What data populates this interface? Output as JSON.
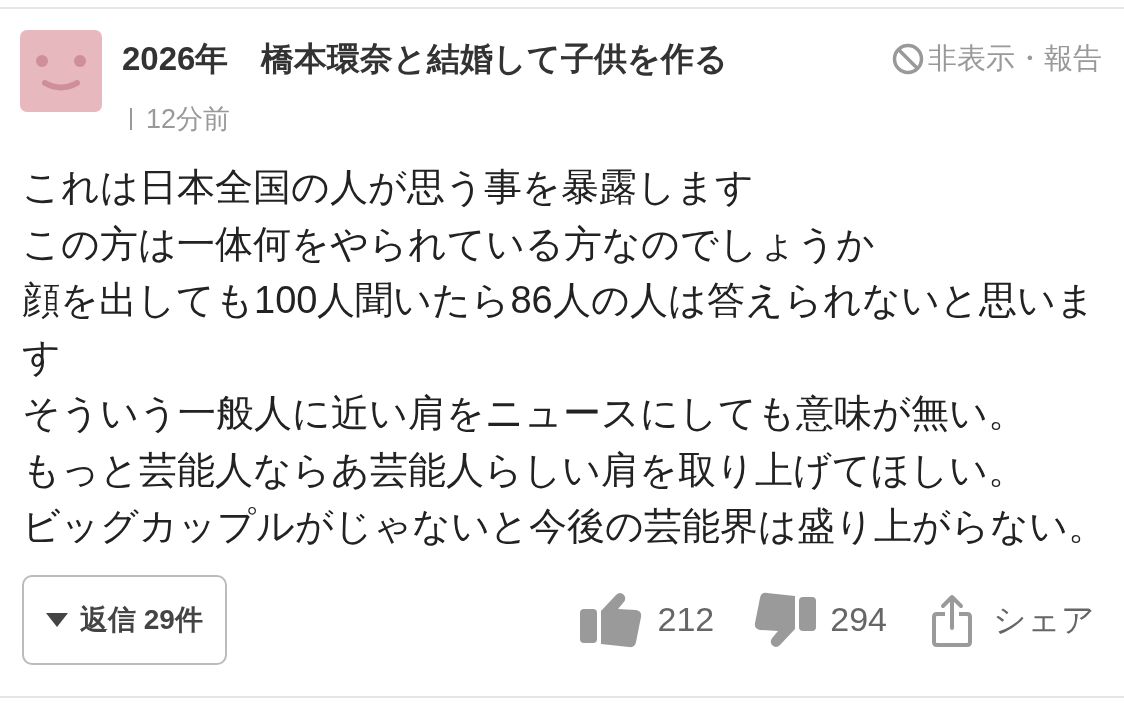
{
  "comment": {
    "author": "2026年　橋本環奈と結婚して子供を作る",
    "time": "12分前",
    "hide_report": "非表示・報告",
    "body_lines": [
      "これは日本全国の人が思う事を暴露します",
      "この方は一体何をやられている方なのでしょうか",
      "顔を出しても100人聞いたら86人の人は答えられないと思います",
      "そういう一般人に近い肩をニュースにしても意味が無い。",
      "もっと芸能人ならあ芸能人らしい肩を取り上げてほしい。",
      "ビッグカップルがじゃないと今後の芸能界は盛り上がらない。"
    ],
    "replies_button": "返信 29件",
    "likes": "212",
    "dislikes": "294",
    "share": "シェア"
  }
}
